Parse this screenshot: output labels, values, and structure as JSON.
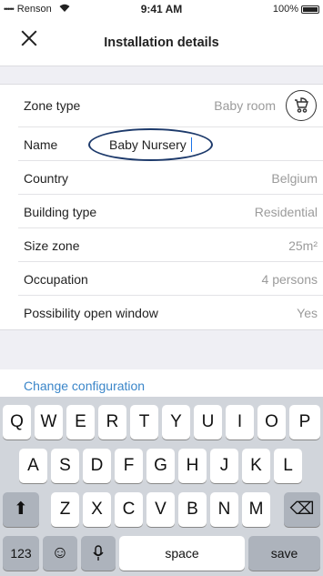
{
  "status_bar": {
    "carrier": "Renson",
    "signal_dots": "•••••",
    "time": "9:41 AM",
    "battery": "100%"
  },
  "nav": {
    "title": "Installation details",
    "close_icon": "close-icon"
  },
  "rows": [
    {
      "label": "Zone type",
      "value": "Baby room"
    },
    {
      "label": "Name",
      "value": "Baby Nursery"
    },
    {
      "label": "Country",
      "value": "Belgium"
    },
    {
      "label": "Building type",
      "value": "Residential"
    },
    {
      "label": "Size zone",
      "value": "25m²"
    },
    {
      "label": "Occupation",
      "value": "4 persons"
    },
    {
      "label": "Possibility open window",
      "value": "Yes"
    }
  ],
  "config": {
    "link": "Change configuration"
  },
  "keyboard": {
    "row1": [
      "Q",
      "W",
      "E",
      "R",
      "T",
      "Y",
      "U",
      "I",
      "O",
      "P"
    ],
    "row2": [
      "A",
      "S",
      "D",
      "F",
      "G",
      "H",
      "J",
      "K",
      "L"
    ],
    "row3": [
      "Z",
      "X",
      "C",
      "V",
      "B",
      "N",
      "M"
    ],
    "shift": "⬆",
    "delete": "⌫",
    "numbers": "123",
    "emoji": "☺",
    "mic": "🎙",
    "space": "space",
    "return": "save"
  },
  "colors": {
    "accent": "#3b86c9",
    "oval": "#1d3a6b",
    "muted": "#9b9b9b"
  }
}
